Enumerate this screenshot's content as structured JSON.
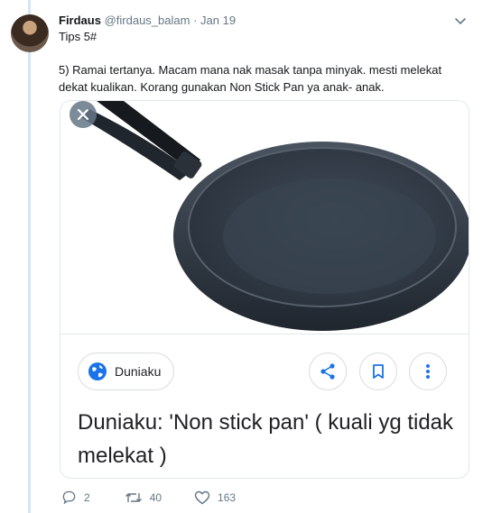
{
  "tweet": {
    "author_name": "Firdaus",
    "handle": "@firdaus_balam",
    "separator": "·",
    "date": "Jan 19",
    "subtitle": "Tips 5#",
    "text": "5) Ramai tertanya. Macam mana nak masak tanpa minyak. mesti melekat dekat kualikan. Korang gunakan Non Stick Pan ya anak- anak."
  },
  "card": {
    "source": "Duniaku",
    "title": "Duniaku: 'Non stick pan' ( kuali yg tidak melekat )",
    "accent_blue": "#1a73e8"
  },
  "actions": {
    "replies": "2",
    "retweets": "40",
    "likes": "163"
  },
  "icons": [
    "chevron-down-icon",
    "close-icon",
    "globe-icon",
    "share-icon",
    "bookmark-icon",
    "more-vertical-icon",
    "reply-icon",
    "retweet-icon",
    "like-icon"
  ]
}
